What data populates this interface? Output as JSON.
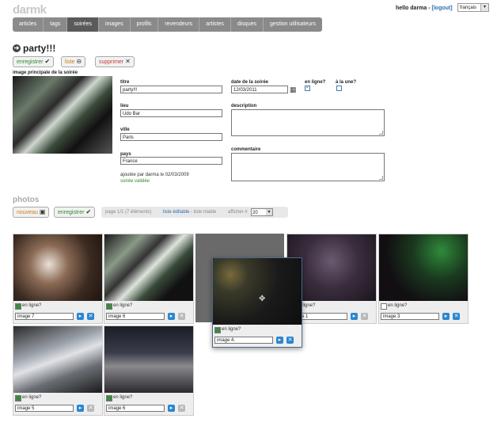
{
  "app": {
    "logo": "darmk"
  },
  "header": {
    "hello": "hello darma - ",
    "logout": "[logout]",
    "language": "français"
  },
  "nav": {
    "items": [
      "articles",
      "tags",
      "soirées",
      "images",
      "profils",
      "revendeurs",
      "artistes",
      "disques",
      "gestion utilisateurs"
    ],
    "active": "soirées"
  },
  "page": {
    "title": "party!!!"
  },
  "actions": {
    "save": "enregistrer",
    "list": "liste",
    "delete": "supprimer"
  },
  "form": {
    "main_image_label": "image principale de la soirée",
    "titre_label": "titre",
    "titre_value": "party!!!",
    "date_label": "date de la soirée",
    "date_value": "12/03/2011",
    "online_label": "en ligne?",
    "une_label": "à la une?",
    "lieu_label": "lieu",
    "lieu_value": "Udo Bar",
    "description_label": "description",
    "ville_label": "ville",
    "ville_value": "Paris",
    "commentaire_label": "commentaire",
    "pays_label": "pays",
    "pays_value": "France",
    "added_by": "ajoutée par darma le 02/03/2009",
    "status": "soirée validée"
  },
  "photos": {
    "title": "photos",
    "new_btn": "nouveau",
    "save_btn": "enregistrer",
    "pager": {
      "page": "page 1/1 (7 éléments)",
      "editable": "liste éditable",
      "sortable": " - liste triable",
      "show": "afficher #",
      "per_page": "20"
    },
    "online_label": "en ligne?",
    "items": [
      {
        "name": "image 7"
      },
      {
        "name": "image 6"
      },
      {
        "name": "image 4."
      },
      {
        "name": "image 1"
      },
      {
        "name": "image 3"
      },
      {
        "name": "image 5"
      },
      {
        "name": "image 6"
      }
    ]
  }
}
